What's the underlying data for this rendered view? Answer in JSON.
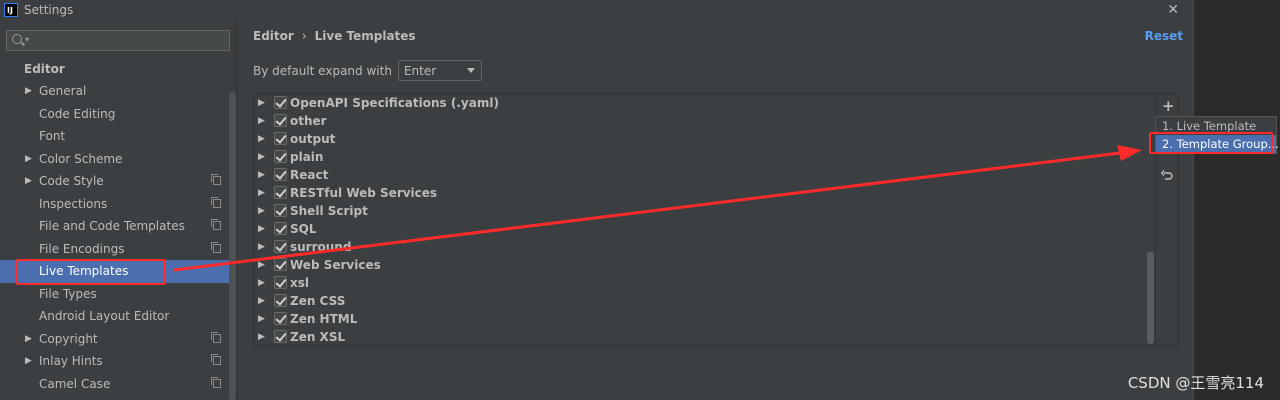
{
  "window": {
    "title": "Settings",
    "app_icon": "IJ"
  },
  "search": {
    "placeholder": ""
  },
  "sidebar": {
    "section": "Editor",
    "items": [
      {
        "label": "General",
        "arrow": true,
        "copy": false
      },
      {
        "label": "Code Editing",
        "arrow": false,
        "copy": false
      },
      {
        "label": "Font",
        "arrow": false,
        "copy": false
      },
      {
        "label": "Color Scheme",
        "arrow": true,
        "copy": false
      },
      {
        "label": "Code Style",
        "arrow": true,
        "copy": true
      },
      {
        "label": "Inspections",
        "arrow": false,
        "copy": true
      },
      {
        "label": "File and Code Templates",
        "arrow": false,
        "copy": true
      },
      {
        "label": "File Encodings",
        "arrow": false,
        "copy": true
      },
      {
        "label": "Live Templates",
        "arrow": false,
        "copy": false,
        "selected": true
      },
      {
        "label": "File Types",
        "arrow": false,
        "copy": false
      },
      {
        "label": "Android Layout Editor",
        "arrow": false,
        "copy": false
      },
      {
        "label": "Copyright",
        "arrow": true,
        "copy": true
      },
      {
        "label": "Inlay Hints",
        "arrow": true,
        "copy": true
      },
      {
        "label": "Camel Case",
        "arrow": false,
        "copy": true
      }
    ]
  },
  "breadcrumb": {
    "parent": "Editor",
    "separator": "›",
    "current": "Live Templates"
  },
  "reset_label": "Reset",
  "expand": {
    "label": "By default expand with",
    "value": "Enter"
  },
  "tree": {
    "groups": [
      "OpenAPI Specifications (.yaml)",
      "other",
      "output",
      "plain",
      "React",
      "RESTful Web Services",
      "Shell Script",
      "SQL",
      "surround",
      "Web Services",
      "xsl",
      "Zen CSS",
      "Zen HTML",
      "Zen XSL"
    ]
  },
  "toolbar": {
    "add_glyph": "+",
    "undo_icon": "undo-icon"
  },
  "popup": {
    "items": [
      "1. Live Template",
      "2. Template Group..."
    ],
    "selected_index": 1
  },
  "watermark": "CSDN @王雪亮114",
  "colors": {
    "highlight_red": "#ff2a2a",
    "selection_blue": "#4b6eaf",
    "link_blue": "#589df6",
    "background": "#3c3f41"
  }
}
